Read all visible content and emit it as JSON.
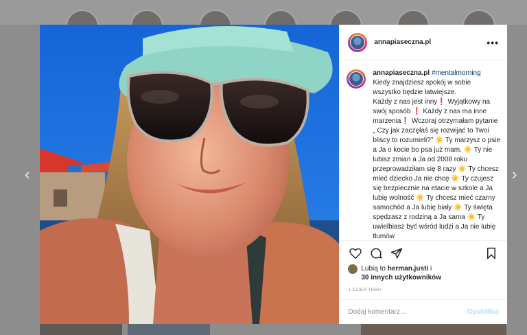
{
  "post": {
    "username": "annapiaseczna.pl",
    "hashtag": "#mentalmorning",
    "caption": "Kiedy znajdziesz spokój w sobie wszystko będzie łatwiejsze.\nKażdy z nas jest inny❗ Wyjątkowy na swój sposób ❗ Każdy z nas ma inne marzenia❗ Wczoraj otrzymałam pytanie „ Czy jak zaczęłaś się rozwijać to Twoi bliscy to rozumieli?” ☀️ Ty marzysz o psie a Ja o kocie bo psa już mam. ☀️ Ty nie lubisz zmian a Ja od 2008 roku przeprowadziłam się 8 razy ☀️ Ty chcesz mieć dziecko Ja nie chcę ☀️ Ty czujesz się bezpiecznie na etacie w szkole a Ja lubię wolność ☀️ Ty chcesz mieć czarny samochód a Ja lubię biały ☀️ Ty święta spędzasz z rodziną a Ja sama ☀️ Ty uwielbiasz być wśród ludzi a Ja nie lubię tłumów",
    "likes": {
      "prefix": "Lubią to",
      "user": "herman.justi",
      "suffix": "i",
      "others": "30 innych użytkowników"
    },
    "time": "1 DZIEŃ TEMU",
    "comment_placeholder": "Dodaj komentarz...",
    "post_label": "Opublikuj",
    "more_label": "•••"
  },
  "nav": {
    "prev": "‹",
    "next": "›"
  },
  "icons": [
    "heart-icon",
    "comment-icon",
    "share-icon",
    "bookmark-icon",
    "more-options-icon"
  ],
  "colors": {
    "link": "#00376b",
    "post_button": "#b2dffc",
    "meta": "#8e8e8e"
  }
}
